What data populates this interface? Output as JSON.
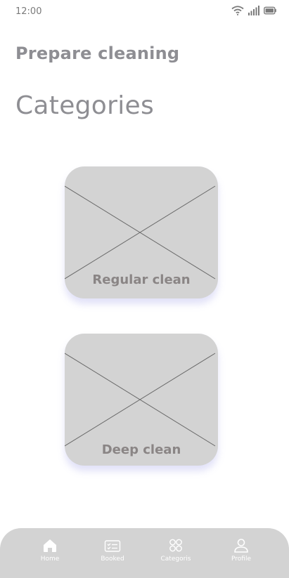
{
  "status_bar": {
    "time": "12:00",
    "icons": [
      "wifi-icon",
      "signal-icon",
      "battery-icon"
    ]
  },
  "header": {
    "title": "Prepare cleaning"
  },
  "main": {
    "section_title": "Categories",
    "categories": [
      {
        "label": "Regular clean",
        "image": "image-placeholder-icon"
      },
      {
        "label": "Deep clean",
        "image": "image-placeholder-icon"
      }
    ]
  },
  "bottom_nav": {
    "items": [
      {
        "label": "Home",
        "icon": "home-icon"
      },
      {
        "label": "Booked",
        "icon": "booked-list-icon"
      },
      {
        "label": "Categoris",
        "icon": "categories-grid-icon"
      },
      {
        "label": "Profile",
        "icon": "profile-icon"
      }
    ]
  },
  "colors": {
    "card_background": "#d3d3d3",
    "heading_text": "#8e8e93",
    "card_label_text": "#8a8585",
    "nav_background": "#d3d3d3",
    "nav_text": "#ffffff"
  }
}
